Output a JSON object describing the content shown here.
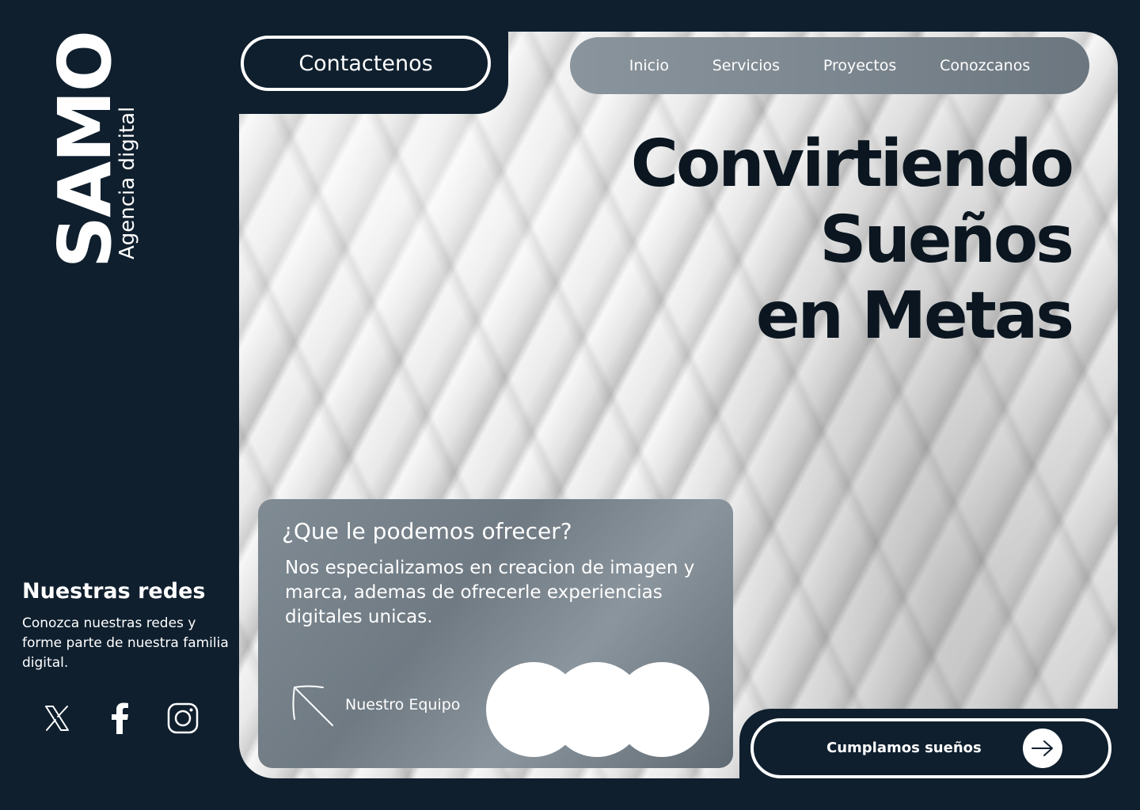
{
  "brand": {
    "name": "SAMO",
    "tagline": "Agencia digital"
  },
  "header": {
    "contact_label": "Contactenos",
    "nav": [
      {
        "label": "Inicio"
      },
      {
        "label": "Servicios"
      },
      {
        "label": "Proyectos"
      },
      {
        "label": "Conozcanos"
      }
    ]
  },
  "hero": {
    "headline_lines": [
      "Convirtiendo",
      "Sueños",
      "en Metas"
    ]
  },
  "offer": {
    "title": "¿Que le podemos ofrecer?",
    "text": "Nos especializamos en creacion de imagen y marca, ademas de ofrecerle experiencias digitales unicas.",
    "team_link_label": "Nuestro Equipo",
    "team_link_icon": "arrow-up-left-icon",
    "avatars_count": 3
  },
  "cta": {
    "label": "Cumplamos sueños",
    "icon": "arrow-right-icon"
  },
  "social": {
    "title": "Nuestras redes",
    "text": "Conozca nuestras redes y forme parte de nuestra familia digital.",
    "icons": [
      "x-icon",
      "facebook-icon",
      "instagram-icon"
    ]
  },
  "colors": {
    "background": "#0f1f2e",
    "headline": "#0b1620",
    "nav_bg": "#7c8790",
    "card_bg": "#6f7a83",
    "white": "#ffffff"
  }
}
